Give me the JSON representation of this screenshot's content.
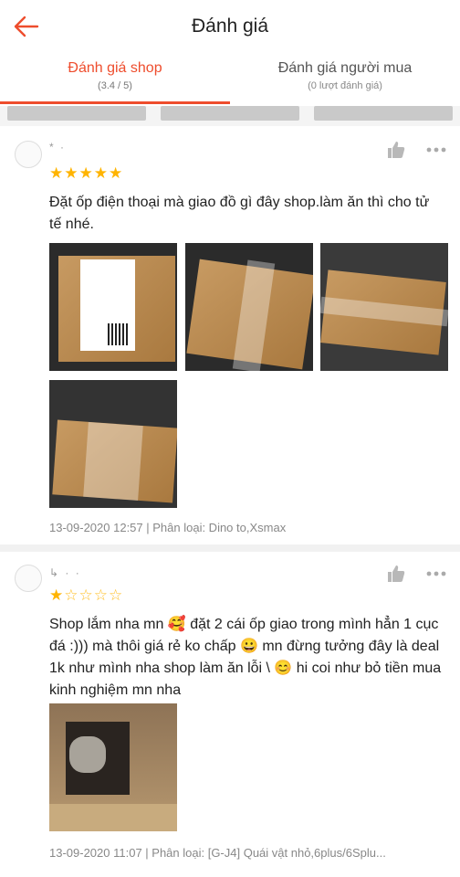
{
  "header": {
    "title": "Đánh giá",
    "back_icon": "back-arrow-icon",
    "accent": "#ee4d2d"
  },
  "tabs": [
    {
      "label": "Đánh giá shop",
      "sub": "(3.4 / 5)",
      "active": true
    },
    {
      "label": "Đánh giá người mua",
      "sub": "(0 lượt đánh giá)",
      "active": false
    }
  ],
  "reviews": [
    {
      "username": "* ·",
      "rating": 5,
      "text": "Đặt ốp điện thoại mà giao đồ gì đây shop.làm ăn thì cho tử tế nhé.",
      "meta": "13-09-2020 12:57 | Phân loại: Dino to,Xsmax",
      "photos": 4
    },
    {
      "username": "↳ · ·",
      "rating": 1,
      "text": "Shop   lắm nha mn 🥰 đặt 2 cái ốp giao trong mình hẳn 1 cục đá :))) mà thôi giá rẻ ko chấp 😀 mn đừng tưởng đây là deal 1k như mình nha shop làm ăn lỗi \\ 😊 hi coi như bỏ tiền mua kinh nghiệm mn nha",
      "meta": "13-09-2020 11:07 | Phân loại: [G-J4] Quái vật nhỏ,6plus/6Splu...",
      "photos": 1
    }
  ]
}
